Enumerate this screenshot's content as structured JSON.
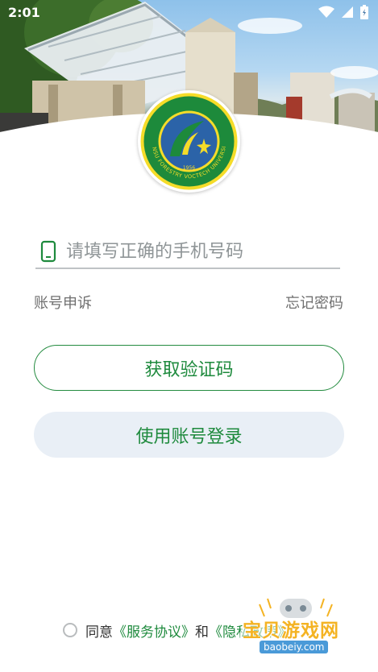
{
  "status_bar": {
    "time": "2:01",
    "icons": [
      "wifi-icon",
      "signal-icon",
      "battery-icon"
    ]
  },
  "header": {
    "logo_icon": "university-emblem",
    "logo_year": "1956",
    "logo_text": "GANSU FORESTRY VOCTECH UNIVERSITY"
  },
  "login": {
    "phone_placeholder": "请填写正确的手机号码",
    "phone_value": "",
    "appeal_label": "账号申诉",
    "forgot_label": "忘记密码",
    "get_code_label": "获取验证码",
    "account_login_label": "使用账号登录"
  },
  "agreement": {
    "prefix": "同意",
    "service_link": "《服务协议》",
    "and": "和",
    "privacy_link": "《隐私政策》"
  },
  "watermark": {
    "text": "宝贝游戏网",
    "url": "baobeiy.com"
  },
  "colors": {
    "accent_green": "#1e8a3d",
    "button_light_bg": "#e9eff6",
    "logo_green": "#1d8a3b",
    "logo_yellow": "#f5dc29"
  }
}
